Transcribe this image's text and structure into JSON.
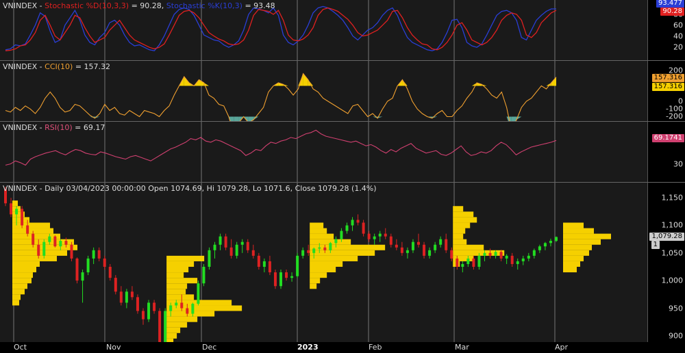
{
  "colors": {
    "bg": "#1a1a1a",
    "grid": "#777777",
    "stoch_d": "#e02020",
    "stoch_k": "#2a3ed6",
    "cci_line": "#f0a030",
    "cci_pos_fill": "#f5d000",
    "cci_neg_fill": "#5aa69a",
    "rsi_line": "#d04070",
    "candle_up": "#22dd22",
    "candle_down": "#dd2222",
    "volume_profile": "#f5d000"
  },
  "x_labels": [
    "Oct",
    "Nov",
    "Dec",
    "2023",
    "Feb",
    "Mar",
    "Apr"
  ],
  "stoch": {
    "title_prefix": "VNINDEX - ",
    "d_label": "Stochastic %D(10,3,3)",
    "d_value": "= 90.28,",
    "k_label": "Stochastic %K(10,3)",
    "k_value": "= 93.48",
    "ticks": [
      "80",
      "60",
      "40",
      "20"
    ],
    "tag_k": "93.477",
    "tag_d": "90.28",
    "d_values": [
      8,
      9,
      12,
      18,
      20,
      30,
      45,
      70,
      80,
      60,
      38,
      30,
      45,
      60,
      80,
      75,
      55,
      38,
      25,
      30,
      35,
      50,
      60,
      70,
      55,
      40,
      30,
      25,
      20,
      15,
      12,
      15,
      22,
      40,
      60,
      80,
      88,
      90,
      85,
      75,
      60,
      45,
      38,
      32,
      28,
      22,
      20,
      22,
      30,
      50,
      80,
      92,
      90,
      88,
      82,
      90,
      70,
      40,
      30,
      28,
      32,
      40,
      55,
      80,
      92,
      95,
      92,
      88,
      80,
      72,
      60,
      45,
      38,
      40,
      45,
      50,
      60,
      70,
      88,
      90,
      75,
      55,
      40,
      30,
      22,
      20,
      12,
      10,
      15,
      25,
      40,
      60,
      65,
      50,
      30,
      25,
      20,
      25,
      35,
      50,
      70,
      80,
      85,
      82,
      70,
      40,
      35,
      45,
      65,
      75,
      85,
      90
    ],
    "k_values": [
      10,
      12,
      20,
      18,
      22,
      40,
      60,
      85,
      78,
      48,
      25,
      30,
      60,
      75,
      90,
      70,
      40,
      25,
      20,
      35,
      45,
      65,
      70,
      60,
      40,
      25,
      18,
      20,
      15,
      10,
      8,
      20,
      38,
      60,
      82,
      92,
      95,
      92,
      80,
      60,
      40,
      35,
      30,
      28,
      20,
      15,
      20,
      28,
      50,
      82,
      95,
      93,
      90,
      85,
      95,
      80,
      40,
      25,
      20,
      28,
      40,
      60,
      85,
      95,
      98,
      95,
      88,
      80,
      70,
      55,
      38,
      30,
      40,
      50,
      55,
      65,
      80,
      90,
      95,
      80,
      55,
      35,
      25,
      20,
      15,
      10,
      8,
      12,
      25,
      45,
      70,
      72,
      55,
      25,
      18,
      15,
      22,
      40,
      60,
      80,
      88,
      90,
      85,
      70,
      35,
      30,
      50,
      70,
      80,
      88,
      93,
      93
    ]
  },
  "cci": {
    "title_prefix": "VNINDEX - ",
    "label": "CCI(10)",
    "value": "= 157.32",
    "ticks": [
      "200",
      "100",
      "0",
      "-100",
      "-200"
    ],
    "tag_1": "157.316",
    "tag_2": "157.316",
    "values": [
      -60,
      -70,
      -40,
      -60,
      -30,
      -50,
      -80,
      -40,
      20,
      60,
      20,
      -40,
      -70,
      -60,
      -20,
      -30,
      -60,
      -90,
      -110,
      -80,
      -20,
      -60,
      -40,
      -80,
      -90,
      -60,
      -80,
      -100,
      -60,
      -70,
      -80,
      -100,
      -60,
      -30,
      40,
      100,
      160,
      120,
      100,
      140,
      120,
      40,
      20,
      -20,
      -30,
      -100,
      -210,
      -140,
      -100,
      -140,
      -120,
      -80,
      -40,
      60,
      100,
      120,
      110,
      80,
      40,
      80,
      180,
      140,
      80,
      60,
      20,
      0,
      -20,
      -40,
      -60,
      -80,
      -30,
      -20,
      -60,
      -100,
      -80,
      -110,
      -50,
      0,
      20,
      100,
      140,
      80,
      0,
      -50,
      -80,
      -100,
      -110,
      -80,
      -60,
      -100,
      -100,
      -60,
      -30,
      20,
      60,
      120,
      110,
      80,
      40,
      20,
      60,
      -40,
      -190,
      -120,
      -40,
      0,
      20,
      60,
      100,
      80,
      120,
      157
    ]
  },
  "rsi": {
    "title_prefix": "VNINDEX - ",
    "label": "RSI(10)",
    "value": "= 69.17",
    "ticks": [
      "30"
    ],
    "tag": "69.1741",
    "values": [
      28,
      30,
      35,
      32,
      28,
      38,
      42,
      45,
      48,
      50,
      52,
      48,
      45,
      50,
      54,
      52,
      48,
      46,
      45,
      50,
      48,
      45,
      42,
      40,
      38,
      42,
      44,
      41,
      38,
      35,
      40,
      45,
      50,
      55,
      58,
      62,
      66,
      72,
      70,
      74,
      68,
      66,
      70,
      68,
      64,
      60,
      56,
      52,
      44,
      48,
      54,
      52,
      60,
      66,
      64,
      68,
      70,
      74,
      72,
      76,
      80,
      82,
      86,
      80,
      76,
      74,
      72,
      70,
      68,
      66,
      68,
      64,
      60,
      62,
      58,
      52,
      48,
      54,
      50,
      56,
      60,
      64,
      56,
      52,
      48,
      50,
      52,
      46,
      44,
      48,
      54,
      60,
      50,
      44,
      46,
      50,
      48,
      52,
      60,
      66,
      62,
      54,
      45,
      50,
      54,
      58,
      60,
      62,
      64,
      66,
      69
    ]
  },
  "price": {
    "title": "VNINDEX - Daily 03/04/2023 00:00:00 Open 1074.69, Hi 1079.28, Lo 1071.6, Close 1079.28 (1.4%)",
    "ticks": [
      "1,150",
      "1,100",
      "1,050",
      "1,000",
      "950",
      "900"
    ],
    "tag_close": "1,079.28",
    "tag_marker": "1",
    "ylim": [
      880,
      1170
    ],
    "candles": [
      [
        1165,
        1170,
        1135,
        1140
      ],
      [
        1140,
        1150,
        1115,
        1120
      ],
      [
        1120,
        1135,
        1100,
        1130
      ],
      [
        1130,
        1135,
        1095,
        1100
      ],
      [
        1100,
        1110,
        1080,
        1085
      ],
      [
        1085,
        1090,
        1060,
        1065
      ],
      [
        1065,
        1075,
        1040,
        1045
      ],
      [
        1045,
        1075,
        1040,
        1070
      ],
      [
        1070,
        1085,
        1065,
        1080
      ],
      [
        1080,
        1082,
        1060,
        1062
      ],
      [
        1062,
        1075,
        1055,
        1072
      ],
      [
        1072,
        1078,
        1060,
        1065
      ],
      [
        1065,
        1070,
        1035,
        1040
      ],
      [
        1040,
        1042,
        995,
        1000
      ],
      [
        1000,
        1020,
        960,
        1015
      ],
      [
        1015,
        1045,
        1010,
        1040
      ],
      [
        1040,
        1060,
        1030,
        1055
      ],
      [
        1055,
        1060,
        1035,
        1040
      ],
      [
        1040,
        1045,
        1020,
        1025
      ],
      [
        1025,
        1030,
        1000,
        1005
      ],
      [
        1005,
        1010,
        975,
        980
      ],
      [
        980,
        990,
        955,
        960
      ],
      [
        960,
        985,
        950,
        980
      ],
      [
        980,
        990,
        965,
        970
      ],
      [
        970,
        975,
        940,
        945
      ],
      [
        945,
        950,
        920,
        930
      ],
      [
        930,
        965,
        925,
        960
      ],
      [
        960,
        965,
        940,
        945
      ],
      [
        945,
        950,
        870,
        880
      ],
      [
        880,
        950,
        875,
        945
      ],
      [
        945,
        960,
        935,
        955
      ],
      [
        955,
        965,
        950,
        960
      ],
      [
        960,
        975,
        945,
        950
      ],
      [
        950,
        958,
        935,
        940
      ],
      [
        940,
        960,
        935,
        958
      ],
      [
        958,
        1000,
        955,
        995
      ],
      [
        995,
        1030,
        990,
        1025
      ],
      [
        1025,
        1060,
        1020,
        1055
      ],
      [
        1055,
        1070,
        1040,
        1065
      ],
      [
        1065,
        1085,
        1055,
        1080
      ],
      [
        1080,
        1085,
        1055,
        1060
      ],
      [
        1060,
        1075,
        1040,
        1045
      ],
      [
        1045,
        1070,
        1040,
        1065
      ],
      [
        1065,
        1075,
        1050,
        1070
      ],
      [
        1070,
        1075,
        1050,
        1055
      ],
      [
        1055,
        1065,
        1040,
        1045
      ],
      [
        1045,
        1050,
        1020,
        1025
      ],
      [
        1025,
        1040,
        1015,
        1035
      ],
      [
        1035,
        1045,
        1010,
        1015
      ],
      [
        1015,
        1020,
        985,
        990
      ],
      [
        990,
        1020,
        985,
        1015
      ],
      [
        1015,
        1020,
        1000,
        1005
      ],
      [
        1005,
        1015,
        998,
        1008
      ],
      [
        1008,
        1050,
        1005,
        1045
      ],
      [
        1045,
        1060,
        1040,
        1055
      ],
      [
        1055,
        1065,
        1045,
        1050
      ],
      [
        1050,
        1060,
        1040,
        1058
      ],
      [
        1058,
        1068,
        1050,
        1060
      ],
      [
        1060,
        1065,
        1050,
        1055
      ],
      [
        1055,
        1070,
        1050,
        1068
      ],
      [
        1068,
        1080,
        1060,
        1075
      ],
      [
        1075,
        1095,
        1070,
        1090
      ],
      [
        1090,
        1105,
        1085,
        1100
      ],
      [
        1100,
        1115,
        1090,
        1110
      ],
      [
        1110,
        1120,
        1100,
        1105
      ],
      [
        1105,
        1110,
        1080,
        1085
      ],
      [
        1085,
        1090,
        1070,
        1075
      ],
      [
        1075,
        1085,
        1065,
        1080
      ],
      [
        1080,
        1090,
        1070,
        1085
      ],
      [
        1085,
        1095,
        1075,
        1080
      ],
      [
        1080,
        1085,
        1060,
        1065
      ],
      [
        1065,
        1075,
        1055,
        1060
      ],
      [
        1060,
        1070,
        1045,
        1050
      ],
      [
        1050,
        1060,
        1040,
        1055
      ],
      [
        1055,
        1075,
        1050,
        1070
      ],
      [
        1070,
        1085,
        1060,
        1065
      ],
      [
        1065,
        1070,
        1040,
        1045
      ],
      [
        1045,
        1060,
        1040,
        1055
      ],
      [
        1055,
        1070,
        1050,
        1065
      ],
      [
        1065,
        1080,
        1060,
        1075
      ],
      [
        1075,
        1085,
        1050,
        1055
      ],
      [
        1055,
        1060,
        1035,
        1040
      ],
      [
        1040,
        1045,
        1020,
        1025
      ],
      [
        1025,
        1035,
        1015,
        1030
      ],
      [
        1030,
        1045,
        1025,
        1040
      ],
      [
        1040,
        1045,
        1020,
        1025
      ],
      [
        1025,
        1050,
        1020,
        1045
      ],
      [
        1045,
        1055,
        1035,
        1050
      ],
      [
        1050,
        1058,
        1040,
        1045
      ],
      [
        1045,
        1055,
        1040,
        1052
      ],
      [
        1052,
        1056,
        1035,
        1040
      ],
      [
        1040,
        1048,
        1030,
        1045
      ],
      [
        1045,
        1050,
        1025,
        1030
      ],
      [
        1030,
        1040,
        1020,
        1035
      ],
      [
        1035,
        1045,
        1028,
        1040
      ],
      [
        1040,
        1050,
        1035,
        1045
      ],
      [
        1045,
        1058,
        1040,
        1055
      ],
      [
        1055,
        1065,
        1050,
        1062
      ],
      [
        1062,
        1070,
        1055,
        1068
      ],
      [
        1068,
        1076,
        1062,
        1072
      ],
      [
        1072,
        1080,
        1070,
        1079
      ]
    ],
    "profiles": [
      [
        [
          1110,
          25
        ],
        [
          1100,
          55
        ],
        [
          1090,
          60
        ],
        [
          1080,
          70
        ],
        [
          1070,
          90
        ],
        [
          1060,
          95
        ],
        [
          1050,
          80
        ],
        [
          1040,
          65
        ],
        [
          1030,
          40
        ],
        [
          1020,
          35
        ],
        [
          1010,
          30
        ],
        [
          1000,
          28
        ],
        [
          990,
          22
        ],
        [
          980,
          18
        ],
        [
          970,
          12
        ],
        [
          960,
          10
        ],
        [
          1120,
          18
        ],
        [
          1130,
          12
        ],
        [
          1140,
          8
        ]
      ],
      [
        [
          1040,
          55
        ],
        [
          1030,
          40
        ],
        [
          1020,
          32
        ],
        [
          1010,
          25
        ],
        [
          1000,
          45
        ],
        [
          990,
          30
        ],
        [
          980,
          28
        ],
        [
          970,
          40
        ],
        [
          960,
          95
        ],
        [
          950,
          110
        ],
        [
          940,
          70
        ],
        [
          930,
          45
        ],
        [
          920,
          30
        ],
        [
          910,
          20
        ],
        [
          900,
          15
        ],
        [
          890,
          10
        ],
        [
          880,
          8
        ]
      ],
      [
        [
          1100,
          20
        ],
        [
          1090,
          25
        ],
        [
          1080,
          35
        ],
        [
          1070,
          60
        ],
        [
          1060,
          110
        ],
        [
          1050,
          95
        ],
        [
          1040,
          70
        ],
        [
          1030,
          48
        ],
        [
          1020,
          38
        ],
        [
          1010,
          25
        ],
        [
          1000,
          15
        ],
        [
          990,
          10
        ]
      ],
      [
        [
          1130,
          15
        ],
        [
          1120,
          30
        ],
        [
          1110,
          35
        ],
        [
          1100,
          25
        ],
        [
          1090,
          18
        ],
        [
          1080,
          15
        ],
        [
          1070,
          20
        ],
        [
          1060,
          45
        ],
        [
          1050,
          75
        ],
        [
          1040,
          30
        ],
        [
          1030,
          10
        ]
      ],
      [
        [
          1100,
          30
        ],
        [
          1090,
          45
        ],
        [
          1080,
          70
        ],
        [
          1070,
          55
        ],
        [
          1060,
          42
        ],
        [
          1050,
          38
        ],
        [
          1040,
          30
        ],
        [
          1030,
          25
        ],
        [
          1020,
          20
        ]
      ],
      [
        [
          1070,
          40
        ],
        [
          1060,
          100
        ],
        [
          1050,
          120
        ],
        [
          1040,
          95
        ],
        [
          1030,
          60
        ],
        [
          1020,
          35
        ],
        [
          1010,
          15
        ]
      ]
    ],
    "profile_starts": [
      0,
      28,
      54,
      80,
      100,
      124
    ],
    "month_breaks": [
      4,
      28,
      54,
      80,
      100,
      124,
      140
    ]
  }
}
